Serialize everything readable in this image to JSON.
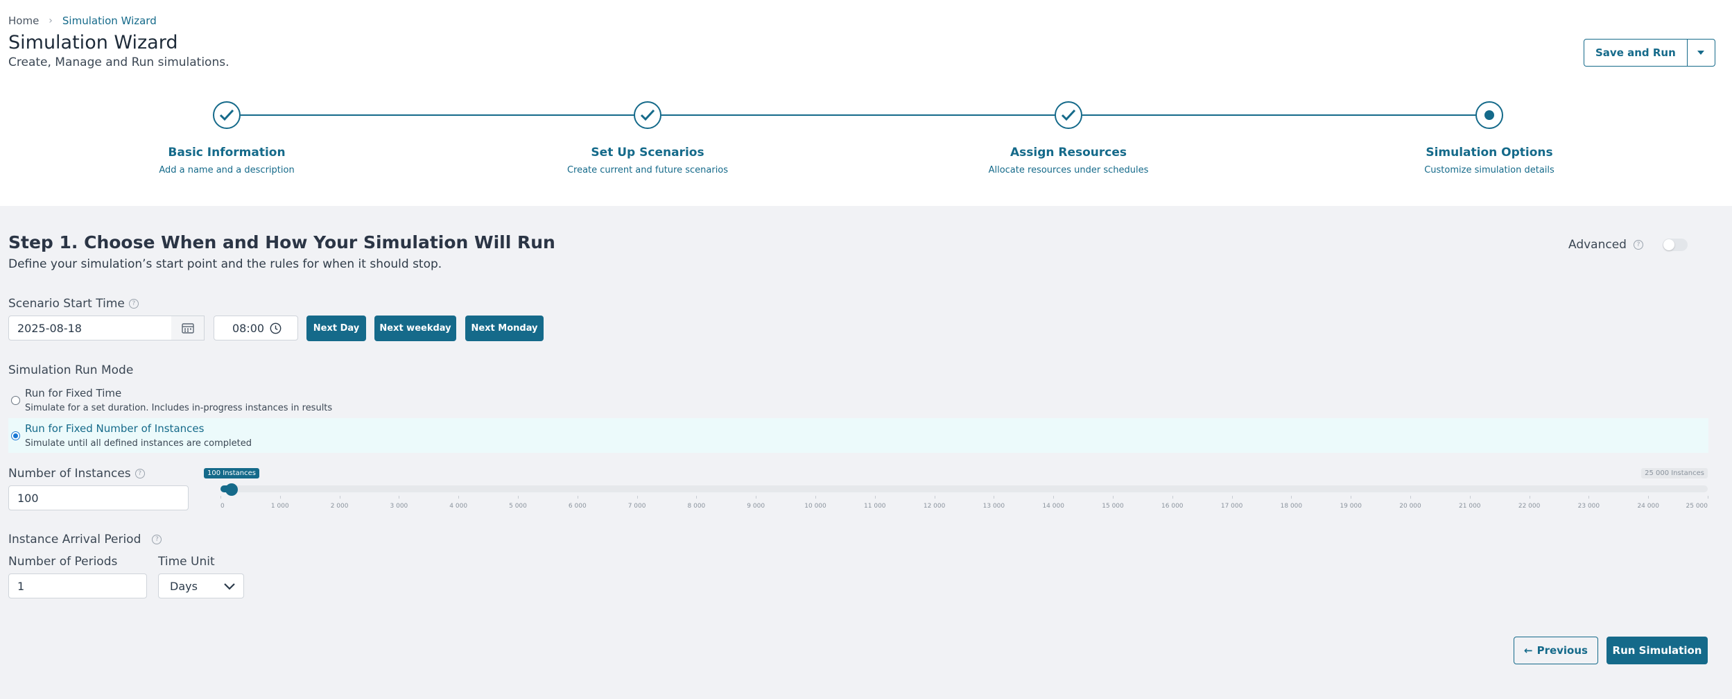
{
  "breadcrumb": {
    "home": "Home",
    "separator": "›",
    "current": "Simulation Wizard"
  },
  "page": {
    "title": "Simulation Wizard",
    "subtitle": "Create, Manage and Run simulations."
  },
  "toolbar": {
    "save_run_label": "Save and Run",
    "caret_icon": "chevron-down-icon"
  },
  "steps": [
    {
      "title": "Basic Information",
      "desc": "Add a name and a description",
      "status": "complete"
    },
    {
      "title": "Set Up Scenarios",
      "desc": "Create current and future scenarios",
      "status": "complete"
    },
    {
      "title": "Assign Resources",
      "desc": "Allocate resources under schedules",
      "status": "complete"
    },
    {
      "title": "Simulation Options",
      "desc": "Customize simulation details",
      "status": "current"
    }
  ],
  "section": {
    "title": "Step 1. Choose When and How Your Simulation Will Run",
    "subtitle": "Define your simulation’s start point and the rules for when it should stop."
  },
  "advanced": {
    "label": "Advanced",
    "help": "?",
    "enabled": false
  },
  "start_time": {
    "label": "Scenario Start Time",
    "help": "?",
    "date": "2025-08-18",
    "time": "08:00",
    "quick_buttons": [
      "Next Day",
      "Next weekday",
      "Next Monday"
    ]
  },
  "run_mode": {
    "label": "Simulation Run Mode",
    "options": [
      {
        "title": "Run for Fixed Time",
        "desc": "Simulate for a set duration. Includes in-progress instances in results",
        "selected": false
      },
      {
        "title": "Run for Fixed Number of Instances",
        "desc": "Simulate until all defined instances are completed",
        "selected": true
      }
    ]
  },
  "instances": {
    "label": "Number of Instances",
    "help": "?",
    "value": "100",
    "slider_value": 100,
    "slider_max": 25000,
    "bubble": "100 Instances",
    "max_bubble": "25 000 Instances",
    "ticks": [
      "0",
      "1 000",
      "2 000",
      "3 000",
      "4 000",
      "5 000",
      "6 000",
      "7 000",
      "8 000",
      "9 000",
      "10 000",
      "11 000",
      "12 000",
      "13 000",
      "14 000",
      "15 000",
      "16 000",
      "17 000",
      "18 000",
      "19 000",
      "20 000",
      "21 000",
      "22 000",
      "23 000",
      "24 000",
      "25 000"
    ]
  },
  "arrival": {
    "label": "Instance Arrival Period",
    "help": "?",
    "periods_label": "Number of Periods",
    "periods_value": "1",
    "unit_label": "Time Unit",
    "unit_value": "Days"
  },
  "footer": {
    "prev_label": "Previous",
    "prev_arrow": "←",
    "run_label": "Run Simulation"
  },
  "colors": {
    "accent": "#156a8a",
    "selected_row": "#ecfafb",
    "background": "#f1f2f5"
  }
}
